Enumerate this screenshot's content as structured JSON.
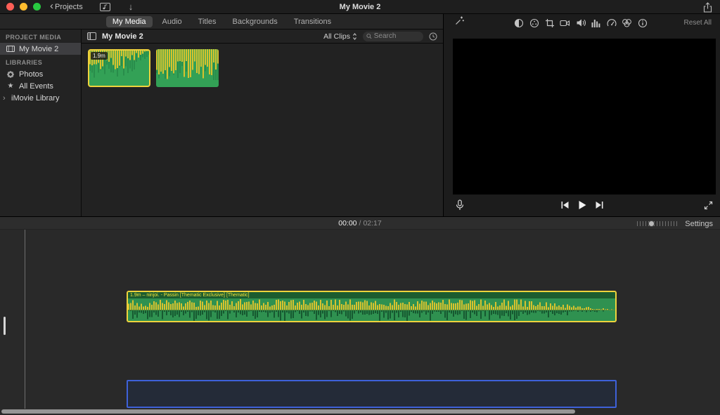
{
  "titlebar": {
    "back_label": "Projects",
    "title": "My Movie 2"
  },
  "tabs": [
    {
      "label": "My Media",
      "active": true
    },
    {
      "label": "Audio",
      "active": false
    },
    {
      "label": "Titles",
      "active": false
    },
    {
      "label": "Backgrounds",
      "active": false
    },
    {
      "label": "Transitions",
      "active": false
    }
  ],
  "viewer": {
    "reset_all_label": "Reset All"
  },
  "sidebar": {
    "project_media_header": "PROJECT MEDIA",
    "project_item": "My Movie 2",
    "libraries_header": "LIBRARIES",
    "photos_item": "Photos",
    "all_events_item": "All Events",
    "imovie_library_item": "iMovie Library"
  },
  "media_browser": {
    "title": "My Movie 2",
    "clips_filter": "All Clips",
    "search_placeholder": "Search",
    "clip_badge": "1.9m"
  },
  "timeline": {
    "current_time": "00:00",
    "separator": "/",
    "duration": "02:17",
    "settings_label": "Settings",
    "audio_clip_label": "1.9m – ninjoi. - Passin [Thematic Exclusive] [Thematic]"
  },
  "icons": {
    "back_chevron": "‹",
    "download_arrow": "↓",
    "disclosure_chevron": "›",
    "star": "★"
  },
  "colors": {
    "accent_yellow": "#eed33c",
    "clip_green": "#33a156",
    "selection_blue": "#3e61d9",
    "traffic_red": "#ff5f57",
    "traffic_yellow": "#febc2e",
    "traffic_green": "#28c840"
  }
}
